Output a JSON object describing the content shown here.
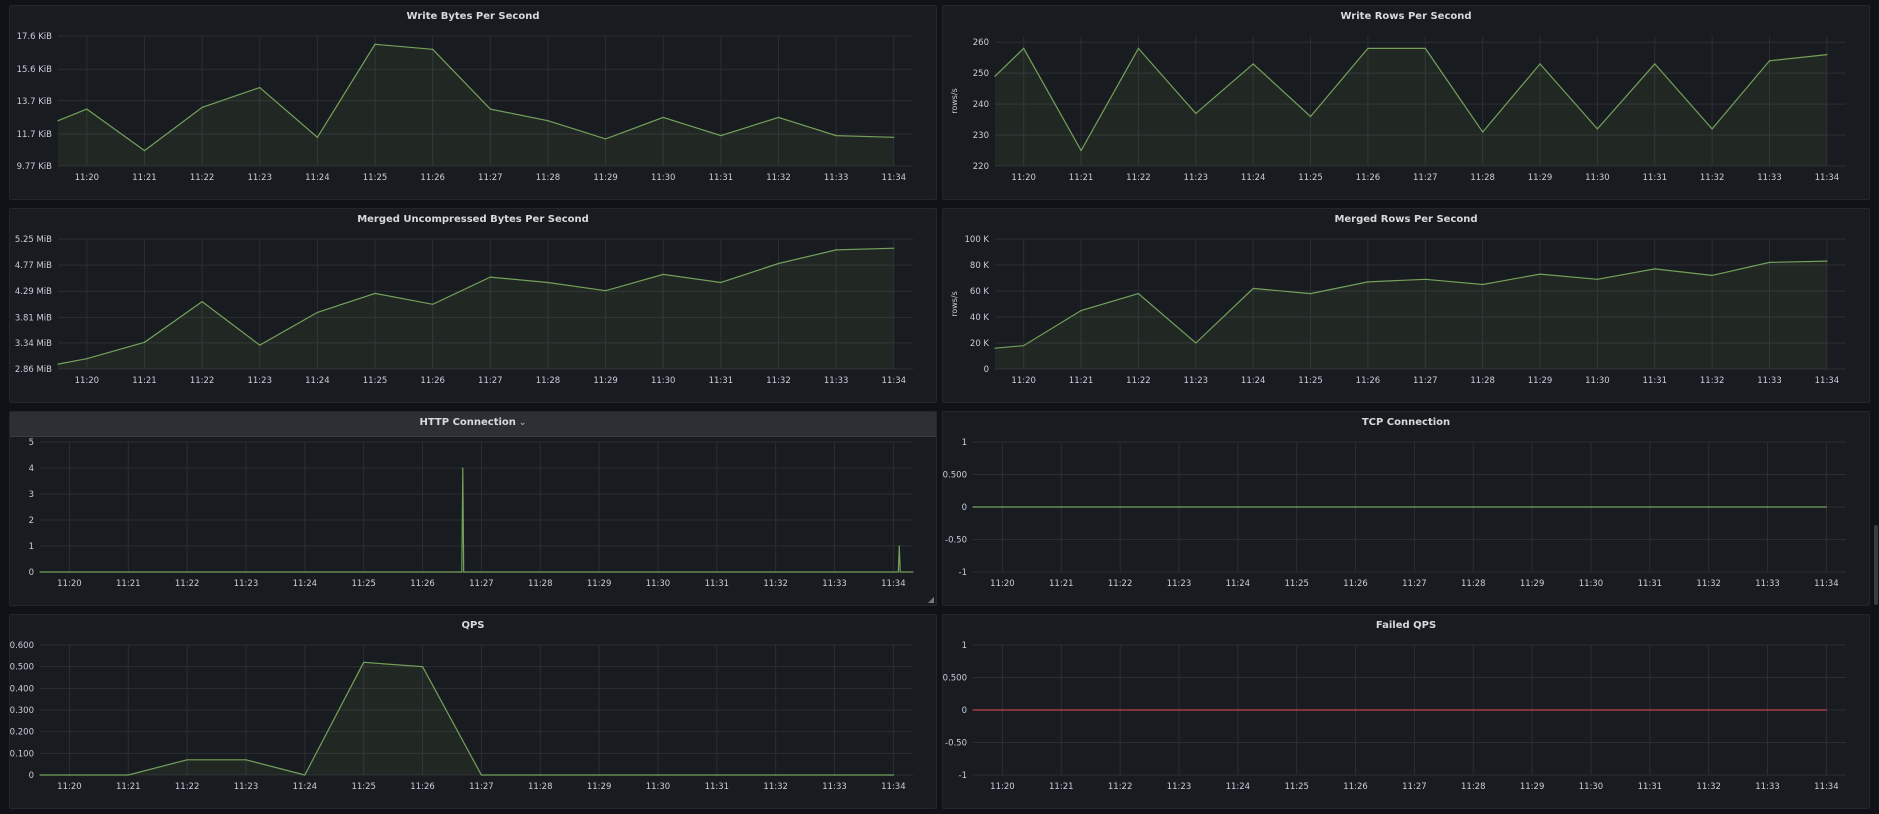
{
  "colors": {
    "series": "#73a05a",
    "failed": "#c4414c",
    "grid": "#2b2e34",
    "text": "#ccccdc"
  },
  "panels": [
    {
      "id": "write-bytes",
      "title": "Write Bytes Per Second",
      "chart_data": {
        "type": "area",
        "title": "Write Bytes Per Second",
        "unit_label": "",
        "x": [
          "11:19:30",
          "11:20",
          "11:21",
          "11:22",
          "11:23",
          "11:24",
          "11:25",
          "11:26",
          "11:27",
          "11:28",
          "11:29",
          "11:30",
          "11:31",
          "11:32",
          "11:33",
          "11:34"
        ],
        "x_tick_labels": [
          "11:20",
          "11:21",
          "11:22",
          "11:23",
          "11:24",
          "11:25",
          "11:26",
          "11:27",
          "11:28",
          "11:29",
          "11:30",
          "11:31",
          "11:32",
          "11:33",
          "11:34"
        ],
        "values": [
          12.5,
          13.2,
          10.7,
          13.3,
          14.5,
          11.5,
          17.1,
          16.8,
          13.2,
          12.5,
          11.4,
          12.7,
          11.6,
          12.7,
          11.6,
          11.5
        ],
        "y_unit": "KiB",
        "ylim": [
          9.77,
          17.6
        ],
        "y_ticks": [
          9.77,
          11.7,
          13.7,
          15.6,
          17.6
        ],
        "y_tick_labels": [
          "9.77 KiB",
          "11.7 KiB",
          "13.7 KiB",
          "15.6 KiB",
          "17.6 KiB"
        ],
        "grid": true
      }
    },
    {
      "id": "write-rows",
      "title": "Write Rows Per Second",
      "chart_data": {
        "type": "area",
        "title": "Write Rows Per Second",
        "unit_label": "rows/s",
        "x": [
          "11:19:30",
          "11:20",
          "11:21",
          "11:22",
          "11:23",
          "11:24",
          "11:25",
          "11:26",
          "11:27",
          "11:28",
          "11:29",
          "11:30",
          "11:31",
          "11:32",
          "11:33",
          "11:34"
        ],
        "x_tick_labels": [
          "11:20",
          "11:21",
          "11:22",
          "11:23",
          "11:24",
          "11:25",
          "11:26",
          "11:27",
          "11:28",
          "11:29",
          "11:30",
          "11:31",
          "11:32",
          "11:33",
          "11:34"
        ],
        "values": [
          249,
          258,
          225,
          258,
          237,
          253,
          236,
          258,
          258,
          231,
          253,
          232,
          253,
          232,
          254,
          256
        ],
        "ylim": [
          220,
          262
        ],
        "y_ticks": [
          220,
          230,
          240,
          250,
          260
        ],
        "y_tick_labels": [
          "220",
          "230",
          "240",
          "250",
          "260"
        ],
        "grid": true
      }
    },
    {
      "id": "merged-uncompressed",
      "title": "Merged Uncompressed Bytes Per Second",
      "chart_data": {
        "type": "area",
        "title": "Merged Uncompressed Bytes Per Second",
        "unit_label": "",
        "x": [
          "11:19:30",
          "11:20",
          "11:21",
          "11:22",
          "11:23",
          "11:24",
          "11:25",
          "11:26",
          "11:27",
          "11:28",
          "11:29",
          "11:30",
          "11:31",
          "11:32",
          "11:33",
          "11:34"
        ],
        "x_tick_labels": [
          "11:20",
          "11:21",
          "11:22",
          "11:23",
          "11:24",
          "11:25",
          "11:26",
          "11:27",
          "11:28",
          "11:29",
          "11:30",
          "11:31",
          "11:32",
          "11:33",
          "11:34"
        ],
        "values": [
          2.95,
          3.05,
          3.35,
          4.1,
          3.3,
          3.9,
          4.25,
          4.05,
          4.55,
          4.45,
          4.3,
          4.6,
          4.45,
          4.8,
          5.05,
          5.08
        ],
        "y_unit": "MiB",
        "ylim": [
          2.86,
          5.25
        ],
        "y_ticks": [
          2.86,
          3.34,
          3.81,
          4.29,
          4.77,
          5.25
        ],
        "y_tick_labels": [
          "2.86 MiB",
          "3.34 MiB",
          "3.81 MiB",
          "4.29 MiB",
          "4.77 MiB",
          "5.25 MiB"
        ],
        "grid": true
      }
    },
    {
      "id": "merged-rows",
      "title": "Merged Rows Per Second",
      "chart_data": {
        "type": "area",
        "title": "Merged Rows Per Second",
        "unit_label": "rows/s",
        "x": [
          "11:19:30",
          "11:20",
          "11:21",
          "11:22",
          "11:23",
          "11:24",
          "11:25",
          "11:26",
          "11:27",
          "11:28",
          "11:29",
          "11:30",
          "11:31",
          "11:32",
          "11:33",
          "11:34"
        ],
        "x_tick_labels": [
          "11:20",
          "11:21",
          "11:22",
          "11:23",
          "11:24",
          "11:25",
          "11:26",
          "11:27",
          "11:28",
          "11:29",
          "11:30",
          "11:31",
          "11:32",
          "11:33",
          "11:34"
        ],
        "values": [
          16000,
          18000,
          45000,
          58000,
          20000,
          62000,
          58000,
          67000,
          69000,
          65000,
          73000,
          69000,
          77000,
          72000,
          82000,
          83000
        ],
        "ylim": [
          0,
          100000
        ],
        "y_ticks": [
          0,
          20000,
          40000,
          60000,
          80000,
          100000
        ],
        "y_tick_labels": [
          "0",
          "20 K",
          "40 K",
          "60 K",
          "80 K",
          "100 K"
        ],
        "grid": true
      }
    },
    {
      "id": "http-connection",
      "title": "HTTP Connection",
      "active": true,
      "chart_data": {
        "type": "line",
        "title": "HTTP Connection",
        "unit_label": "",
        "x": [
          "11:19:30",
          "11:26:40",
          "11:26:41",
          "11:26:42",
          "11:34:05",
          "11:34:06",
          "11:34:07",
          "11:34:20"
        ],
        "x_tick_labels": [
          "11:20",
          "11:21",
          "11:22",
          "11:23",
          "11:24",
          "11:25",
          "11:26",
          "11:27",
          "11:28",
          "11:29",
          "11:30",
          "11:31",
          "11:32",
          "11:33",
          "11:34"
        ],
        "values": [
          0,
          0,
          4,
          0,
          0,
          1,
          0,
          0
        ],
        "ylim": [
          0,
          5
        ],
        "y_ticks": [
          0,
          1,
          2,
          3,
          4,
          5
        ],
        "y_tick_labels": [
          "0",
          "1",
          "2",
          "3",
          "4",
          "5"
        ],
        "grid": true
      }
    },
    {
      "id": "tcp-connection",
      "title": "TCP Connection",
      "chart_data": {
        "type": "line",
        "title": "TCP Connection",
        "unit_label": "",
        "x": [
          "11:19:30",
          "11:34"
        ],
        "x_tick_labels": [
          "11:20",
          "11:21",
          "11:22",
          "11:23",
          "11:24",
          "11:25",
          "11:26",
          "11:27",
          "11:28",
          "11:29",
          "11:30",
          "11:31",
          "11:32",
          "11:33",
          "11:34"
        ],
        "values": [
          0,
          0
        ],
        "ylim": [
          -1,
          1
        ],
        "y_ticks": [
          -1,
          -0.5,
          0,
          0.5,
          1
        ],
        "y_tick_labels": [
          "-1",
          "-0.50",
          "0",
          "0.500",
          "1"
        ],
        "grid": true
      }
    },
    {
      "id": "qps",
      "title": "QPS",
      "chart_data": {
        "type": "area",
        "title": "QPS",
        "unit_label": "",
        "x": [
          "11:19:30",
          "11:20",
          "11:21",
          "11:22",
          "11:23",
          "11:24",
          "11:25",
          "11:26",
          "11:27",
          "11:28",
          "11:29",
          "11:30",
          "11:31",
          "11:32",
          "11:33",
          "11:34"
        ],
        "x_tick_labels": [
          "11:20",
          "11:21",
          "11:22",
          "11:23",
          "11:24",
          "11:25",
          "11:26",
          "11:27",
          "11:28",
          "11:29",
          "11:30",
          "11:31",
          "11:32",
          "11:33",
          "11:34"
        ],
        "values": [
          0,
          0,
          0,
          0.07,
          0.07,
          0,
          0.52,
          0.5,
          0,
          0,
          0,
          0,
          0,
          0,
          0,
          0
        ],
        "ylim": [
          0,
          0.6
        ],
        "y_ticks": [
          0,
          0.1,
          0.2,
          0.3,
          0.4,
          0.5,
          0.6
        ],
        "y_tick_labels": [
          "0",
          "0.100",
          "0.200",
          "0.300",
          "0.400",
          "0.500",
          "0.600"
        ],
        "grid": true
      }
    },
    {
      "id": "failed-qps",
      "title": "Failed QPS",
      "chart_data": {
        "type": "line",
        "title": "Failed QPS",
        "unit_label": "",
        "x": [
          "11:19:30",
          "11:34"
        ],
        "x_tick_labels": [
          "11:20",
          "11:21",
          "11:22",
          "11:23",
          "11:24",
          "11:25",
          "11:26",
          "11:27",
          "11:28",
          "11:29",
          "11:30",
          "11:31",
          "11:32",
          "11:33",
          "11:34"
        ],
        "values": [
          0,
          0
        ],
        "ylim": [
          -1,
          1
        ],
        "y_ticks": [
          -1,
          -0.5,
          0,
          0.5,
          1
        ],
        "y_tick_labels": [
          "-1",
          "-0.50",
          "0",
          "0.500",
          "1"
        ],
        "grid": true,
        "series_color": "#c4414c"
      }
    }
  ]
}
